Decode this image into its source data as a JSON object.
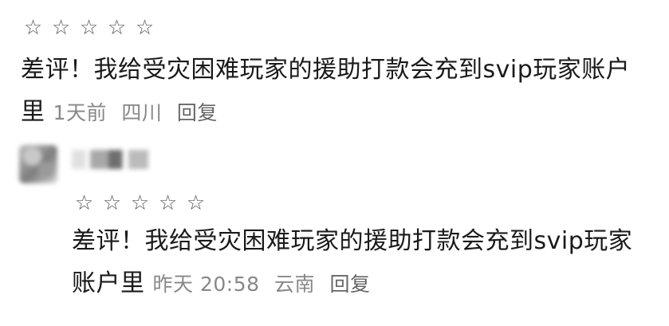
{
  "comments": [
    {
      "rating": 0,
      "star_glyph": "☆",
      "text": "差评！我给受灾困难玩家的援助打款会充到svip玩家账户里",
      "time": "1天前",
      "location": "四川",
      "reply_label": "回复"
    },
    {
      "username": "",
      "rating": 0,
      "star_glyph": "☆",
      "text": "差评！我给受灾困难玩家的援助打款会充到svip玩家账户里",
      "time": "昨天 20:58",
      "location": "云南",
      "reply_label": "回复"
    }
  ],
  "colors": {
    "text": "#1a1a1a",
    "meta": "#888888",
    "star": "#555555"
  }
}
